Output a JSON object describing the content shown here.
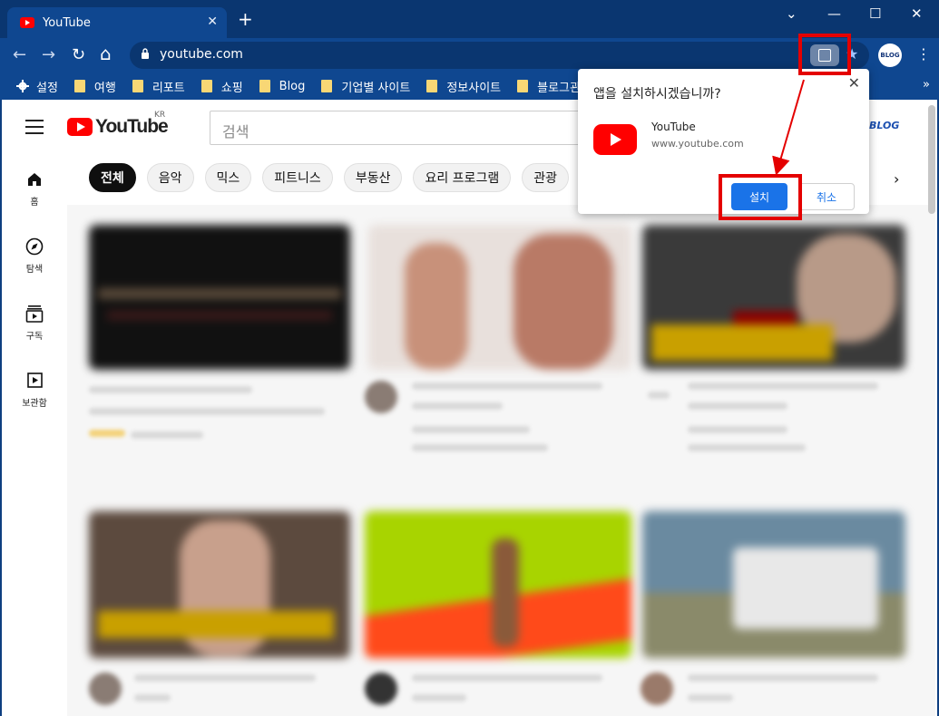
{
  "tab": {
    "title": "YouTube",
    "close": "✕"
  },
  "window": {
    "new_tab": "+",
    "dropdown": "⌄",
    "minimize": "—",
    "maximize": "☐",
    "close": "✕"
  },
  "toolbar": {
    "back": "←",
    "forward": "→",
    "reload": "↻",
    "home": "⌂",
    "url": "youtube.com",
    "star": "★",
    "profile": "BLOG",
    "menu": "⋮"
  },
  "bookmarks": {
    "items": [
      {
        "label": "설정",
        "icon": "gear-icon"
      },
      {
        "label": "여행",
        "icon": "folder-icon"
      },
      {
        "label": "리포트",
        "icon": "folder-icon"
      },
      {
        "label": "쇼핑",
        "icon": "folder-icon"
      },
      {
        "label": "Blog",
        "icon": "folder-icon"
      },
      {
        "label": "기업별 사이트",
        "icon": "folder-icon"
      },
      {
        "label": "정보사이트",
        "icon": "folder-icon"
      },
      {
        "label": "블로그관",
        "icon": "folder-icon"
      }
    ],
    "more": "»"
  },
  "youtube": {
    "logo_word": "YouTube",
    "region": "KR",
    "search_placeholder": "검색",
    "profile_badge": "BLOG",
    "chips": [
      "전체",
      "음악",
      "믹스",
      "피트니스",
      "부동산",
      "요리 프로그램",
      "관광"
    ],
    "chip_next": "›",
    "nav": [
      {
        "label": "홈",
        "icon": "home-icon"
      },
      {
        "label": "탐색",
        "icon": "compass-icon"
      },
      {
        "label": "구독",
        "icon": "subscriptions-icon"
      },
      {
        "label": "보관함",
        "icon": "library-icon"
      }
    ]
  },
  "popup": {
    "title": "앱을 설치하시겠습니까?",
    "app_name": "YouTube",
    "app_url": "www.youtube.com",
    "install": "설치",
    "cancel": "취소",
    "close": "✕"
  },
  "colors": {
    "chrome_frame": "#0a3670",
    "toolbar": "#0f4790",
    "brand_red": "#ff0000",
    "accent_blue": "#1a73e8",
    "highlight": "#e40000"
  }
}
